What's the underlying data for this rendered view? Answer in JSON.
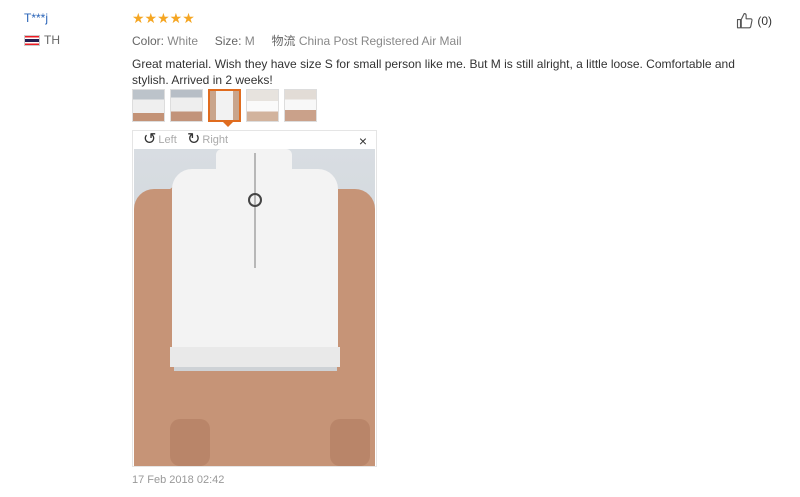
{
  "reviewer": {
    "name": "T***j",
    "country_code": "TH"
  },
  "review": {
    "stars": "★★★★★",
    "color_label": "Color:",
    "color_value": "White",
    "size_label": "Size:",
    "size_value": "M",
    "shipping_label": "物流",
    "shipping_value": "China Post Registered Air Mail",
    "text": "Great material. Wish they have size S for small person like me. But M is still alright, a little loose. Comfortable and stylish. Arrived in 2 weeks!",
    "date": "17 Feb 2018 02:42"
  },
  "viewer": {
    "rotate_left": "Left",
    "rotate_right": "Right",
    "close": "×"
  },
  "likes": {
    "count": "(0)"
  },
  "colors": {
    "accent": "#e06c1f",
    "star": "#f5a623",
    "name": "#2a64b8"
  }
}
